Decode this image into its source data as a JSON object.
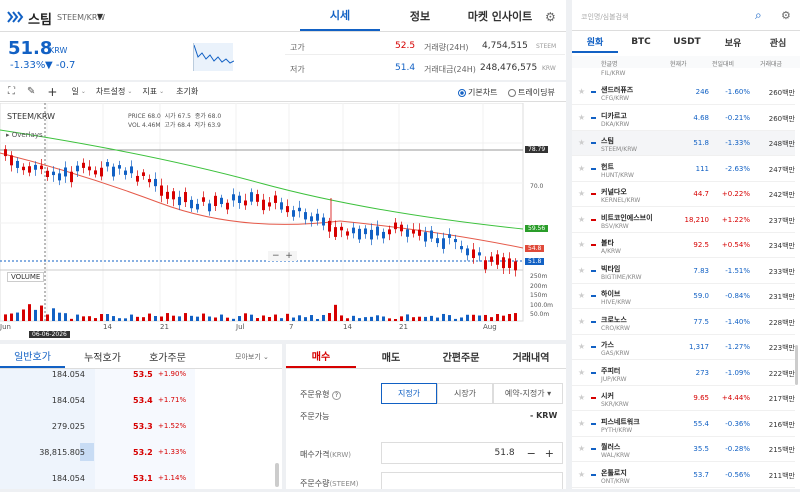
{
  "header": {
    "coin_name": "스팀",
    "pair": "STEEM/KRW",
    "price": "51.8",
    "currency": "KRW",
    "change_pct": "-1.33%",
    "change_abs": "▼ -0.7",
    "tabs": [
      {
        "label": "시세"
      },
      {
        "label": "정보"
      },
      {
        "label": "마켓 인사이트"
      }
    ],
    "stats": {
      "high_label": "고가",
      "high": "52.5",
      "low_label": "저가",
      "low": "51.4",
      "vol_label": "거래량(24H)",
      "vol": "4,754,515",
      "vol_unit": "STEEM",
      "amt_label": "거래대금(24H)",
      "amt": "248,476,575",
      "amt_unit": "KRW"
    }
  },
  "toolbar": {
    "period": "일",
    "settings": "차트설정",
    "indicator": "지표",
    "reset": "초기화",
    "basic": "기본차트",
    "tv": "트레이딩뷰"
  },
  "chart": {
    "symbol": "STEEM/KRW",
    "overlays": "Overlays",
    "volume": "VOLUME",
    "info": {
      "price_l": "PRICE",
      "price": "68.0",
      "open_l": "시가",
      "open": "67.5",
      "close_l": "종가",
      "close": "68.0",
      "vol_l": "VOL",
      "vol": "4.46M",
      "high_l": "고가",
      "high": "68.4",
      "low_l": "저가",
      "low": "63.9"
    },
    "tag_high": "78.79",
    "tag_ma": "59.56",
    "tag_ma2": "54.8",
    "tag_cur": "51.8",
    "tick_70": "70.0",
    "vol_ticks": [
      "250m",
      "200m",
      "150m",
      "100.0m",
      "50.0m"
    ],
    "x_labels": [
      "Jun",
      "14",
      "21",
      "Jul",
      "7",
      "14",
      "21",
      "Aug"
    ],
    "date_box": "06-06-2026"
  },
  "orderbook": {
    "tabs": [
      "일반호가",
      "누적호가",
      "호가주문"
    ],
    "view": "모아보기",
    "rows": [
      {
        "qty": "184.054",
        "price": "53.5",
        "pct": "+1.90%"
      },
      {
        "qty": "184.054",
        "price": "53.4",
        "pct": "+1.71%"
      },
      {
        "qty": "279.025",
        "price": "53.3",
        "pct": "+1.52%"
      },
      {
        "qty": "38,815.805",
        "price": "53.2",
        "pct": "+1.33%"
      },
      {
        "qty": "184.054",
        "price": "53.1",
        "pct": "+1.14%"
      }
    ]
  },
  "order": {
    "tabs": [
      "매수",
      "매도",
      "간편주문",
      "거래내역"
    ],
    "type_label": "주문유형",
    "types": [
      "지정가",
      "시장가",
      "예약-지정가"
    ],
    "avail_label": "주문가능",
    "avail_val": "- KRW",
    "price_label": "매수가격",
    "price_unit": "(KRW)",
    "price_val": "51.8",
    "qty_label": "주문수량",
    "qty_unit": "(STEEM)"
  },
  "sidebar": {
    "search_placeholder": "코인명/심볼검색",
    "tabs": [
      "원화",
      "BTC",
      "USDT",
      "보유",
      "관심"
    ],
    "cols": [
      "한글명",
      "현재가",
      "전일대비",
      "거래대금"
    ],
    "partial": "FIL/KRW",
    "rows": [
      {
        "name": "샌드러퓨즈",
        "sym": "CFG/KRW",
        "price": "246",
        "pct": "-1.60%",
        "amt": "260백만",
        "dir": "down"
      },
      {
        "name": "디카르고",
        "sym": "DKA/KRW",
        "price": "4.68",
        "pct": "-0.21%",
        "amt": "260백만",
        "dir": "down"
      },
      {
        "name": "스팀",
        "sym": "STEEM/KRW",
        "price": "51.8",
        "pct": "-1.33%",
        "amt": "248백만",
        "dir": "down"
      },
      {
        "name": "헌트",
        "sym": "HUNT/KRW",
        "price": "111",
        "pct": "-2.63%",
        "amt": "247백만",
        "dir": "down"
      },
      {
        "name": "커널다오",
        "sym": "KERNEL/KRW",
        "price": "44.7",
        "pct": "+0.22%",
        "amt": "242백만",
        "dir": "up"
      },
      {
        "name": "비트코인에스브이",
        "sym": "BSV/KRW",
        "price": "18,210",
        "pct": "+1.22%",
        "amt": "237백만",
        "dir": "up"
      },
      {
        "name": "볼타",
        "sym": "A/KRW",
        "price": "92.5",
        "pct": "+0.54%",
        "amt": "234백만",
        "dir": "up"
      },
      {
        "name": "빅타임",
        "sym": "BIGTIME/KRW",
        "price": "7.83",
        "pct": "-1.51%",
        "amt": "233백만",
        "dir": "down"
      },
      {
        "name": "하이브",
        "sym": "HIVE/KRW",
        "price": "59.0",
        "pct": "-0.84%",
        "amt": "231백만",
        "dir": "down"
      },
      {
        "name": "크로노스",
        "sym": "CRO/KRW",
        "price": "77.5",
        "pct": "-1.40%",
        "amt": "228백만",
        "dir": "down"
      },
      {
        "name": "가스",
        "sym": "GAS/KRW",
        "price": "1,317",
        "pct": "-1.27%",
        "amt": "223백만",
        "dir": "down"
      },
      {
        "name": "주피터",
        "sym": "JUP/KRW",
        "price": "273",
        "pct": "-1.09%",
        "amt": "222백만",
        "dir": "down"
      },
      {
        "name": "시커",
        "sym": "SKR/KRW",
        "price": "9.65",
        "pct": "+4.44%",
        "amt": "217백만",
        "dir": "up"
      },
      {
        "name": "피스네트워크",
        "sym": "PYTH/KRW",
        "price": "55.4",
        "pct": "-0.36%",
        "amt": "216백만",
        "dir": "down"
      },
      {
        "name": "월러스",
        "sym": "WAL/KRW",
        "price": "35.5",
        "pct": "-0.28%",
        "amt": "215백만",
        "dir": "down"
      },
      {
        "name": "온톨로지",
        "sym": "ONT/KRW",
        "price": "53.7",
        "pct": "-0.56%",
        "amt": "211백만",
        "dir": "down"
      }
    ]
  },
  "colors": {
    "accent": "#1261c4",
    "up": "#d60000",
    "down": "#1261c4"
  }
}
